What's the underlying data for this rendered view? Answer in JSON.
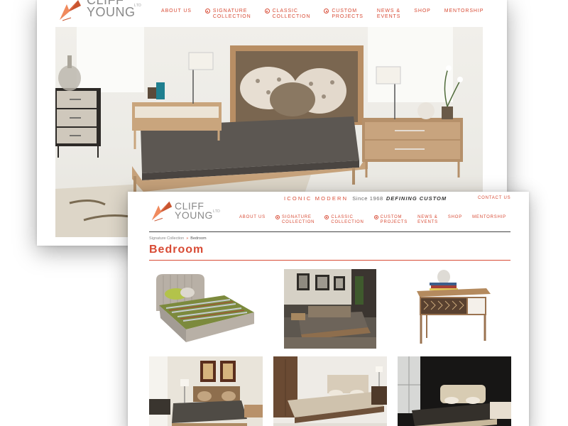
{
  "brand": {
    "logo_line1": "CLIFF",
    "logo_line2": "YOUNG",
    "logo_ltd": "LTD",
    "logo_colors": {
      "orange": "#e0663d",
      "grey": "#8a8a8a"
    }
  },
  "back_window": {
    "nav": [
      {
        "label": "ABOUT US",
        "dot": false
      },
      {
        "label": "SIGNATURE\nCOLLECTION",
        "dot": true
      },
      {
        "label": "CLASSIC\nCOLLECTION",
        "dot": true
      },
      {
        "label": "CUSTOM\nPROJECTS",
        "dot": true
      },
      {
        "label": "NEWS &\nEVENTS",
        "dot": false
      },
      {
        "label": "SHOP",
        "dot": false
      },
      {
        "label": "MENTORSHIP",
        "dot": false
      }
    ],
    "hero": {
      "subject": "bedroom-scene-photo"
    }
  },
  "front_window": {
    "tagline": {
      "part1": "ICONIC MODERN",
      "part2": "Since 1968",
      "part3": "DEFINING CUSTOM"
    },
    "contact_label": "CONTACT US",
    "nav": [
      {
        "label": "ABOUT US",
        "dot": false
      },
      {
        "label": "SIGNATURE\nCOLLECTION",
        "dot": true
      },
      {
        "label": "CLASSIC\nCOLLECTION",
        "dot": true
      },
      {
        "label": "CUSTOM\nPROJECTS",
        "dot": true
      },
      {
        "label": "NEWS &\nEVENTS",
        "dot": false
      },
      {
        "label": "SHOP",
        "dot": false
      },
      {
        "label": "MENTORSHIP",
        "dot": false
      }
    ],
    "breadcrumb": {
      "parent": "Signature Collection",
      "separator": "»",
      "current": "Bedroom"
    },
    "page_title": "Bedroom",
    "thumbnails": [
      {
        "subject": "upholstered-bed-green-stripe"
      },
      {
        "subject": "bedroom-with-framed-photos"
      },
      {
        "subject": "nightstand-with-books"
      },
      {
        "subject": "bedroom-with-art-frames"
      },
      {
        "subject": "bed-with-tall-cabinet"
      },
      {
        "subject": "bed-dark-wall-window"
      }
    ]
  },
  "colors": {
    "accent": "#d84b35",
    "text_grey": "#888888",
    "rule_dark": "#444444"
  }
}
